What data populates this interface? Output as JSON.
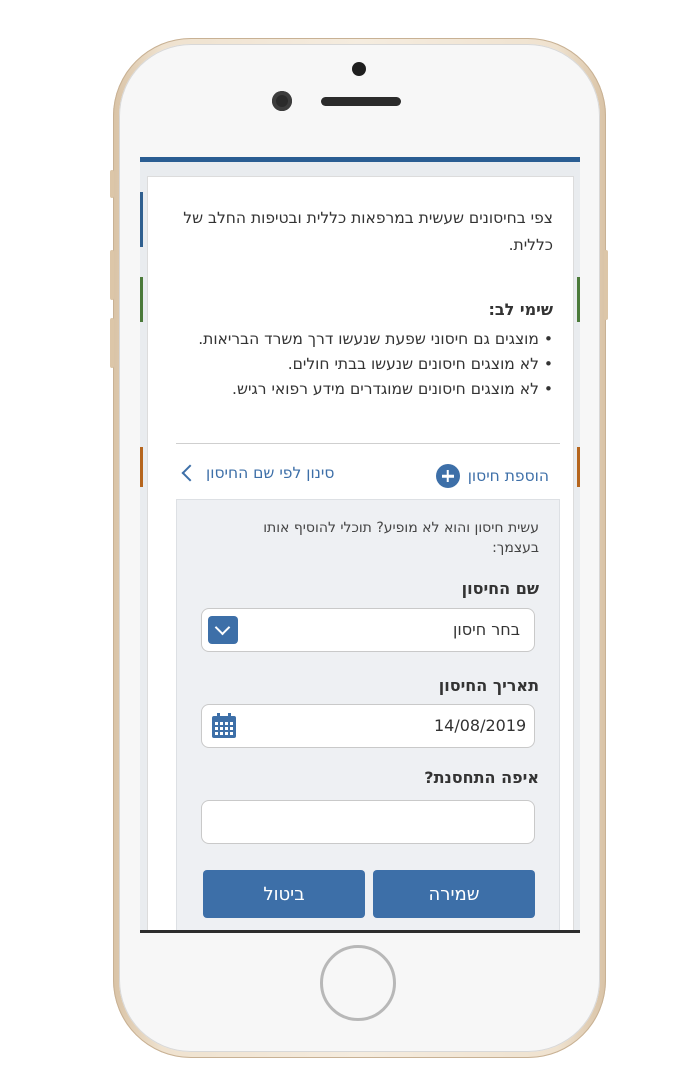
{
  "intro_text": "צפי בחיסונים שעשית במרפאות כללית ובטיפות החלב של כללית.",
  "notice": {
    "title": "שימי לב:",
    "items": [
      "מוצגים גם חיסוני שפעת שנעשו דרך משרד הבריאות.",
      "לא מוצגים חיסונים שנעשו בבתי חולים.",
      "לא מוצגים חיסונים שמוגדרים מידע רפואי רגיש."
    ]
  },
  "actions": {
    "add_vaccine": "הוספת חיסון",
    "filter_by_name": "סינון לפי שם החיסון"
  },
  "form": {
    "hint": "עשית חיסון והוא לא מופיע? תוכלי להוסיף אותו בעצמך:",
    "vaccine_name_label": "שם החיסון",
    "vaccine_name_value": "בחר חיסון",
    "vaccine_date_label": "תאריך החיסון",
    "vaccine_date_value": "14/08/2019",
    "location_label": "איפה התחסנת?",
    "location_value": "",
    "save_label": "שמירה",
    "cancel_label": "ביטול"
  },
  "colors": {
    "accent": "#3d6fa8",
    "panel": "#eef0f3",
    "text": "#333333"
  },
  "icons": {
    "add": "plus-circle-icon",
    "filter": "chevron-left-icon",
    "dropdown": "chevron-down-icon",
    "date": "calendar-icon"
  }
}
